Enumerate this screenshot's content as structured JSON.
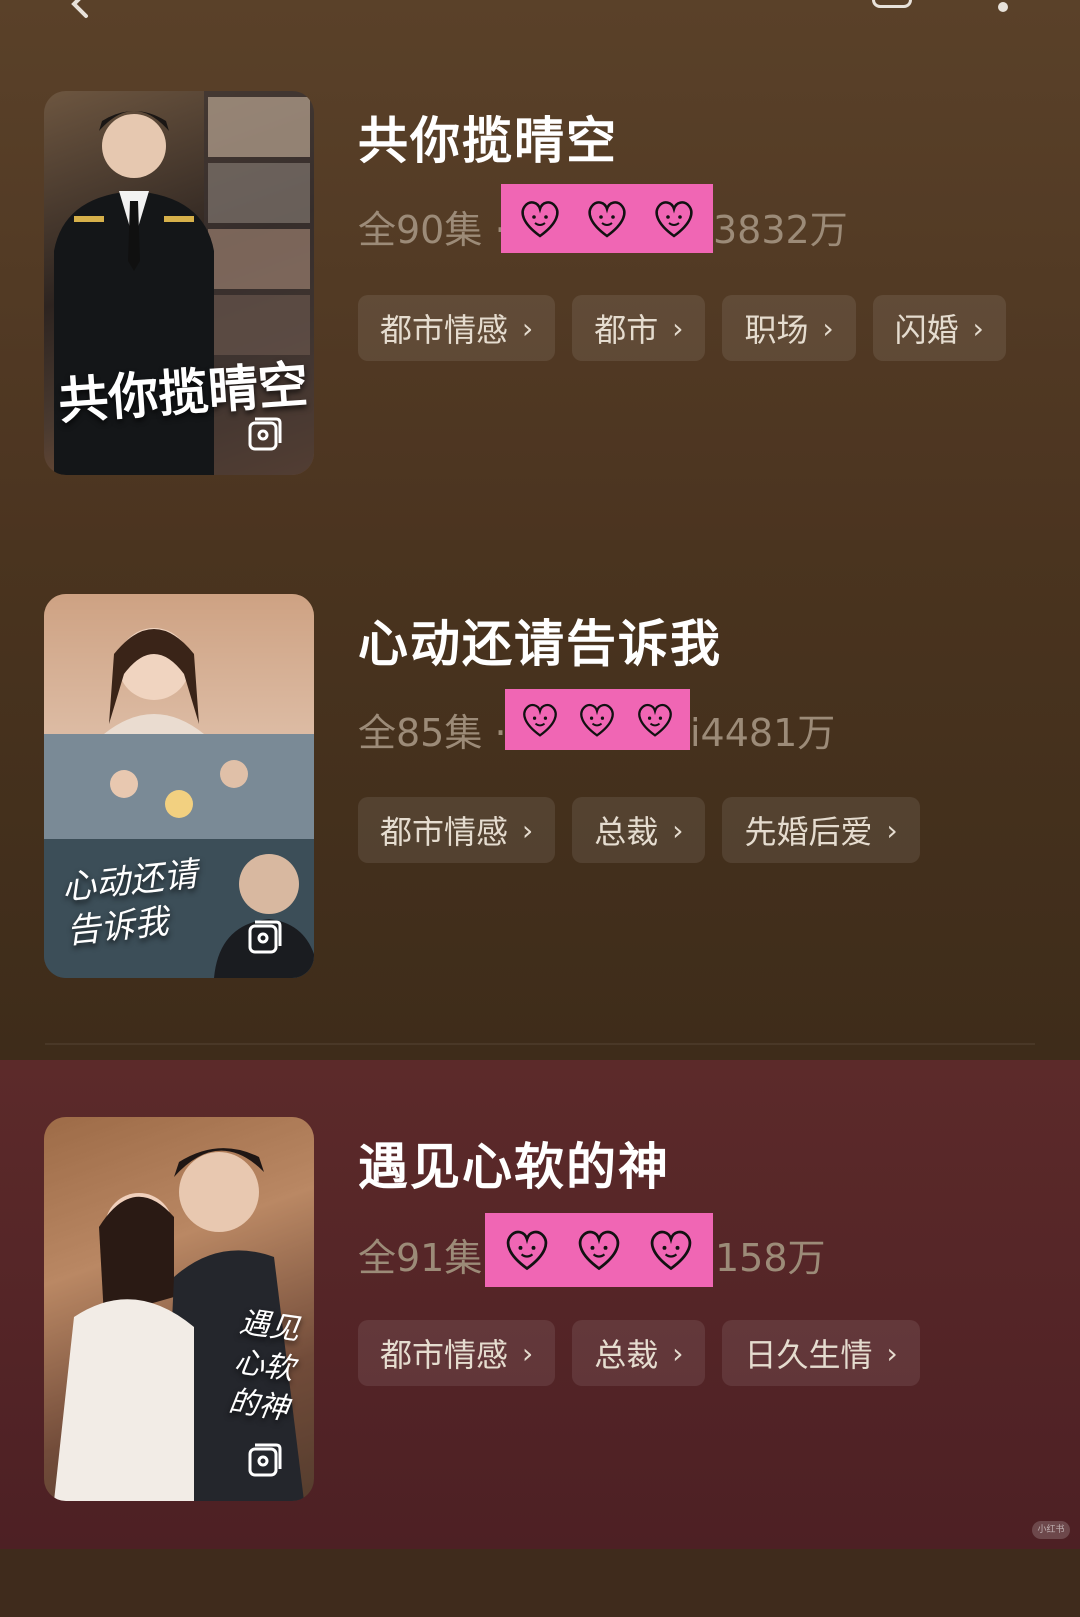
{
  "topbar": {
    "back_icon": "chevron-left-icon",
    "square_icon": "share-square-icon",
    "more_icon": "more-dots-icon"
  },
  "dramas": [
    {
      "title": "共你揽晴空",
      "poster_title": "共你揽晴空",
      "episodes": "全90集",
      "separator": "·",
      "meta_tail": "3832万",
      "tags": [
        "都市情感",
        "都市",
        "职场",
        "闪婚"
      ]
    },
    {
      "title": "心动还请告诉我",
      "poster_title": "心动还请告诉我",
      "episodes": "全85集",
      "separator": "·",
      "meta_tail": "i4481万",
      "tags": [
        "都市情感",
        "总裁",
        "先婚后爱"
      ]
    },
    {
      "title": "遇见心软的神",
      "poster_title": "遇见心软的神",
      "episodes": "全91集",
      "separator": "",
      "meta_tail": "158万",
      "tags": [
        "都市情感",
        "总裁",
        "日久生情"
      ]
    }
  ],
  "chevron": "›",
  "colors": {
    "heart_sticker": "#f066b4",
    "tag_bg": "rgba(255,255,255,0.09)",
    "meta_text": "#9c8b78"
  },
  "watermark": "小红书"
}
